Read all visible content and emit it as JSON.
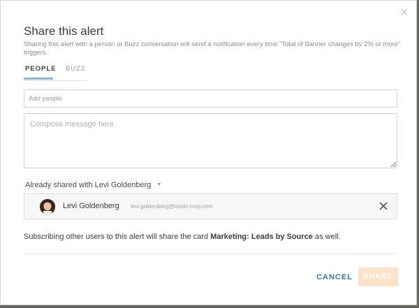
{
  "modal": {
    "title": "Share this alert",
    "subtitle": "Sharing this alert with a person or Buzz conversation will send a notification every time \"Total of Banner changes by 2% or more\" triggers.",
    "close_icon": "close-icon"
  },
  "tabs": [
    {
      "label": "PEOPLE",
      "active": true
    },
    {
      "label": "BUZZ",
      "active": false
    }
  ],
  "add_people": {
    "placeholder": "Add people",
    "value": ""
  },
  "message": {
    "placeholder": "Compose message here.",
    "value": ""
  },
  "shared": {
    "heading": "Already shared with Levi Goldenberg",
    "caret_icon": "caret-down-icon",
    "users": [
      {
        "name": "Levi Goldenberg",
        "email": "levi.goldenberg@modo-corp.com",
        "avatar_icon": "avatar",
        "remove_icon": "close-icon"
      }
    ]
  },
  "note": {
    "prefix": "Subscribing other users to this alert will share the card ",
    "card_name": "Marketing: Leads by Source",
    "suffix": " as well."
  },
  "actions": {
    "cancel_label": "CANCEL",
    "share_label": "SHARE"
  },
  "colors": {
    "accent": "#2f7aa8",
    "tab_underline": "#7fb8d6",
    "share_disabled": "#fde3c6"
  }
}
